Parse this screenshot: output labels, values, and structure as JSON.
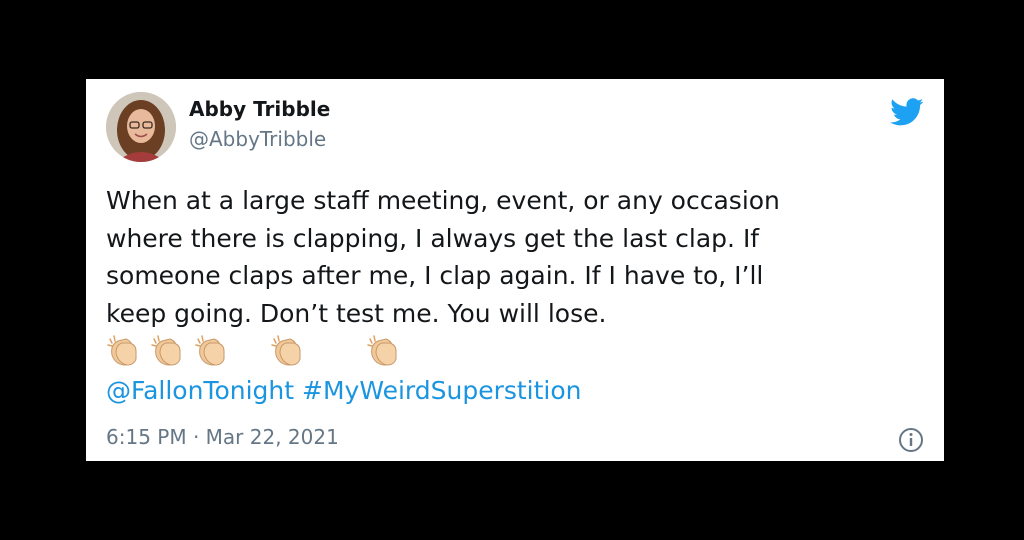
{
  "author": {
    "display_name": "Abby Tribble",
    "handle": "@AbbyTribble"
  },
  "tweet": {
    "text": "When at a large staff meeting, event, or any occasion\nwhere there is clapping, I always get the last clap. If\nsomeone claps after me, I clap again. If I have to, I’ll\nkeep going. Don’t test me. You will lose.",
    "emojis": [
      "clapping-hands",
      "clapping-hands",
      "clapping-hands",
      "clapping-hands",
      "clapping-hands"
    ],
    "mention": "@FallonTonight",
    "hashtag": "#MyWeirdSuperstition",
    "timestamp": "6:15 PM · Mar 22, 2021"
  },
  "icons": {
    "logo": "twitter-bird-icon",
    "info": "info-icon"
  },
  "colors": {
    "background": "#000000",
    "card": "#ffffff",
    "text": "#14171a",
    "muted": "#657786",
    "link": "#1b95e0",
    "twitter_blue": "#1da1f2"
  }
}
